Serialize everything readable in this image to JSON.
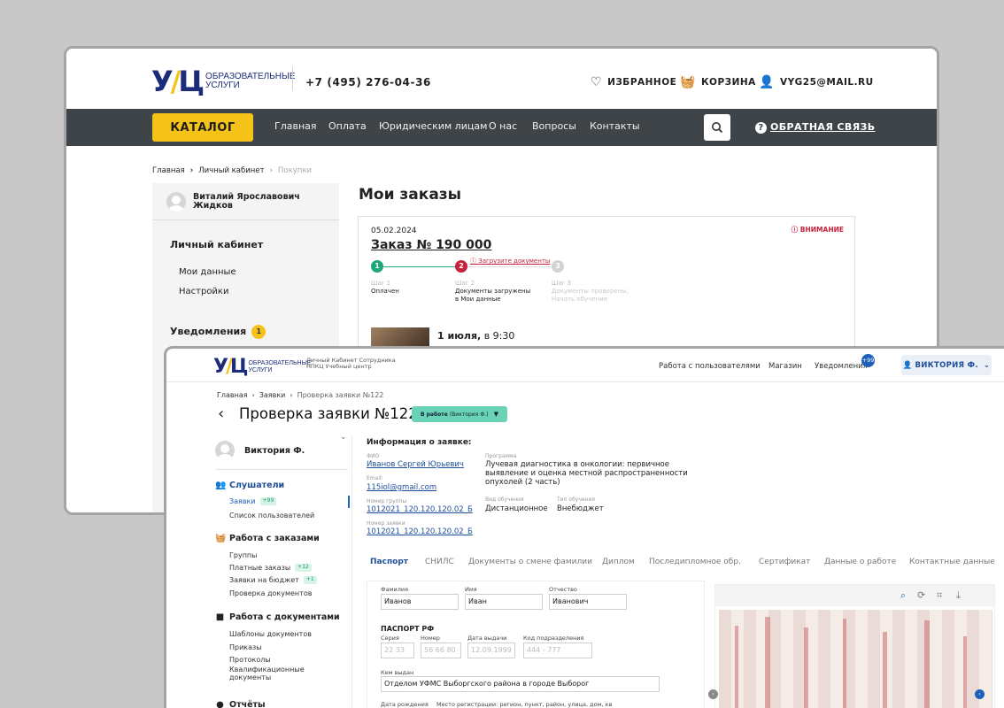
{
  "site": {
    "logo_text_line1": "ОБРАЗОВАТЕЛЬНЫЕ",
    "logo_text_line2": "УСЛУГИ",
    "phone": "+7 (495) 276-04-36",
    "favorites": "ИЗБРАННОЕ",
    "cart": "КОРЗИНА",
    "email": "VYG25@MAIL.RU",
    "catalog_button": "КАТАЛОГ",
    "nav": [
      "Главная",
      "Оплата",
      "Юридическим лицам",
      "О нас",
      "Вопросы",
      "Контакты"
    ],
    "feedback": "ОБРАТНАЯ СВЯЗЬ",
    "breadcrumb": [
      "Главная",
      "Личный кабинет",
      "Покупки"
    ],
    "user_name_line1": "Виталий Ярославович",
    "user_name_line2": "Жидков",
    "cabinet_heading": "Личный кабинет",
    "cabinet_items": [
      "Мои данные",
      "Настройки"
    ],
    "notifications_heading": "Уведомления",
    "notifications_count": "1",
    "page_title": "Мои заказы",
    "order": {
      "date": "05.02.2024",
      "warning": "ВНИМАНИЕ",
      "title": "Заказ № 190 000",
      "upload_docs": "Загрузите документы",
      "steps": [
        {
          "num": "1",
          "key": "Шаг 1",
          "label_line1": "Оплачен",
          "label_line2": ""
        },
        {
          "num": "2",
          "key": "Шаг 2",
          "label_line1": "Документы загружены",
          "label_line2": "в Мои данные"
        },
        {
          "num": "3",
          "key": "Шаг 3",
          "label_line1": "Документы проверены,",
          "label_line2": "Начать обучение"
        }
      ],
      "session_date": "1 июля,",
      "session_time": "в 9:30"
    }
  },
  "crm": {
    "logo_text_line1": "ОБРАЗОВАТЕЛЬНЫЕ",
    "logo_text_line2": "УСЛУГИ",
    "subtitle_line1": "Личный Кабинет Сотрудника",
    "subtitle_line2": "НПКЦ Учебный центр",
    "menu": [
      "Работа с пользователями",
      "Магазин",
      "Уведомления"
    ],
    "notif_badge": "+99",
    "user_button": "ВИКТОРИЯ Ф.",
    "breadcrumb": [
      "Главная",
      "Заявки",
      "Проверка заявки №122"
    ],
    "page_title": "Проверка заявки №122",
    "status_bold": "В работе",
    "status_rest": "(Виктория Ф.)",
    "side_user": "Виктория Ф.",
    "sections": {
      "listeners": {
        "title": "Слушатели",
        "items": [
          {
            "label": "Заявки",
            "badge": "+99"
          },
          {
            "label": "Список пользователей"
          }
        ]
      },
      "orders": {
        "title": "Работа с заказами",
        "items": [
          {
            "label": "Группы"
          },
          {
            "label": "Платные заказы",
            "badge": "+12"
          },
          {
            "label": "Заявки на бюджет",
            "badge": "+1"
          },
          {
            "label": "Проверка документов"
          }
        ]
      },
      "documents": {
        "title": "Работа с документами",
        "items": [
          "Шаблоны документов",
          "Приказы",
          "Протоколы",
          "Квалификационные",
          "документы"
        ]
      },
      "reports": {
        "title": "Отчёты"
      }
    },
    "info": {
      "heading": "Информация о заявке:",
      "fio_key": "ФИО",
      "fio": "Иванов Сергей Юрьевич",
      "email_key": "Email:",
      "email": "115iol@gmail.com",
      "group_key": "Номер группы",
      "group": "1012021_120.120.120.02_Б",
      "request_key": "Номер заявки",
      "request": "1012021_120.120.120.02_Б",
      "program_key": "Программа",
      "program_line1": "Лучевая диагностика в онкологии: первичное",
      "program_line2": "выявление и оценка местной распространенности",
      "program_line3": "опухолей (2 часть)",
      "study_kind_key": "Вид обучения",
      "study_kind": "Дистанционное",
      "study_type_key": "Тип обучения",
      "study_type": "Внебюджет"
    },
    "tabs": [
      "Паспорт",
      "СНИЛС",
      "Документы о смене фамилии",
      "Диплом",
      "Последипломное обр.",
      "Сертификат",
      "Данные о работе",
      "Контактные данные"
    ],
    "form": {
      "surname_label": "Фамилия",
      "surname": "Иванов",
      "name_label": "Имя",
      "name": "Иван",
      "patronymic_label": "Отчество",
      "patronymic": "Иванович",
      "passport_heading": "ПАСПОРТ РФ",
      "series_label": "Серия",
      "series": "22 33",
      "number_label": "Номер",
      "number": "56 66 80",
      "issue_date_label": "Дата выдачи",
      "issue_date": "12.09.1999",
      "dept_code_label": "Код подразделения",
      "dept_code": "444 - 777",
      "issued_by_label": "Кем выдан",
      "issued_by": "Отделом УФМС Выборгского района в городе Выборог",
      "birth_date_label": "Дата рождения",
      "registration_label": "Место регистрации: регион, пункт, район, улица, дом, кв"
    }
  }
}
